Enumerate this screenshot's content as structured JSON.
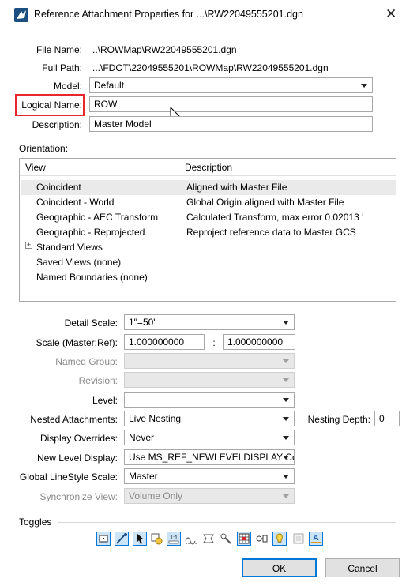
{
  "window": {
    "title": "Reference Attachment Properties for ...\\RW22049555201.dgn",
    "close_label": "✕"
  },
  "file": {
    "file_name_label": "File Name:",
    "file_name_value": "..\\ROWMap\\RW22049555201.dgn",
    "full_path_label": "Full Path:",
    "full_path_value": "...\\FDOT\\22049555201\\ROWMap\\RW22049555201.dgn",
    "model_label": "Model:",
    "model_value": "Default",
    "logical_name_label": "Logical Name:",
    "logical_name_value": "ROW",
    "description_label": "Description:",
    "description_value": "Master Model"
  },
  "orientation": {
    "label": "Orientation:",
    "col_view": "View",
    "col_description": "Description",
    "rows": [
      {
        "view": "Coincident",
        "description": "Aligned with Master File"
      },
      {
        "view": "Coincident - World",
        "description": "Global Origin aligned with Master File"
      },
      {
        "view": "Geographic - AEC Transform",
        "description": "Calculated Transform, max error 0.02013 '"
      },
      {
        "view": "Geographic - Reprojected",
        "description": "Reproject reference data to Master GCS"
      },
      {
        "view": "Standard Views",
        "description": ""
      },
      {
        "view": "Saved Views (none)",
        "description": ""
      },
      {
        "view": "Named Boundaries (none)",
        "description": ""
      }
    ]
  },
  "settings": {
    "detail_scale_label": "Detail Scale:",
    "detail_scale_value": "1\"=50'",
    "scale_label": "Scale (Master:Ref):",
    "scale_master": "1.000000000",
    "scale_sep": ":",
    "scale_ref": "1.000000000",
    "named_group_label": "Named Group:",
    "named_group_value": "",
    "revision_label": "Revision:",
    "revision_value": "",
    "level_label": "Level:",
    "level_value": "",
    "nested_label": "Nested Attachments:",
    "nested_value": "Live Nesting",
    "nesting_depth_label": "Nesting Depth:",
    "nesting_depth_value": "0",
    "display_overrides_label": "Display Overrides:",
    "display_overrides_value": "Never",
    "new_level_label": "New Level Display:",
    "new_level_value": "Use MS_REF_NEWLEVELDISPLAY Co",
    "linestyle_label": "Global LineStyle Scale:",
    "linestyle_value": "Master",
    "sync_label": "Synchronize View:",
    "sync_value": "Volume Only"
  },
  "toggles": {
    "label": "Toggles"
  },
  "buttons": {
    "ok": "OK",
    "cancel": "Cancel"
  },
  "colors": {
    "accent": "#0078d7",
    "highlight": "#e8262c"
  }
}
